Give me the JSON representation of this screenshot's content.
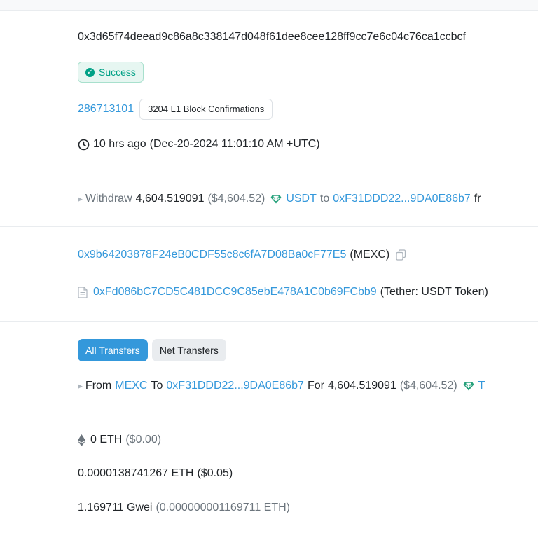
{
  "tx_hash": "0x3d65f74deead9c86a8c338147d048f61dee8cee128ff9cc7e6c04c76ca1ccbcf",
  "status": {
    "label": "Success",
    "icon": "check-circle-icon"
  },
  "block": {
    "number": "286713101",
    "confirmations": "3204 L1 Block Confirmations"
  },
  "timestamp": {
    "icon": "clock-icon",
    "relative": "10 hrs ago",
    "absolute": "(Dec-20-2024 11:01:10 AM +UTC)"
  },
  "action": {
    "verb": "Withdraw",
    "amount": "4,604.519091",
    "usd": "($4,604.52)",
    "token": "USDT",
    "to_word": "to",
    "to_address": "0xF31DDD22...9DA0E86b7",
    "trailing": "fr"
  },
  "from": {
    "address": "0x9b64203878F24eB0CDF55c8c6fA7D08Ba0cF77E5",
    "label": "(MEXC)",
    "icon": "copy-icon"
  },
  "interacted_to": {
    "icon": "contract-file-icon",
    "address": "0xFd086bC7CD5C481DCC9C85ebE478A1C0b69FCbb9",
    "label": "(Tether: USDT Token)"
  },
  "transfers": {
    "tabs": [
      "All Transfers",
      "Net Transfers"
    ],
    "active_tab": 0,
    "from_word": "From",
    "from_name": "MEXC",
    "to_word": "To",
    "to_address": "0xF31DDD22...9DA0E86b7",
    "for_word": "For",
    "amount": "4,604.519091",
    "usd": "($4,604.52)",
    "trailing": "T"
  },
  "value": {
    "icon": "ethereum-icon",
    "amount": "0 ETH",
    "usd": "($0.00)"
  },
  "fee": {
    "amount": "0.0000138741267 ETH",
    "usd": "($0.05)"
  },
  "gas_price": {
    "gwei": "1.169711 Gwei",
    "eth": "(0.000000001169711 ETH)"
  },
  "colors": {
    "link": "#3498db",
    "success": "#00a186",
    "tether": "#26a17b"
  }
}
